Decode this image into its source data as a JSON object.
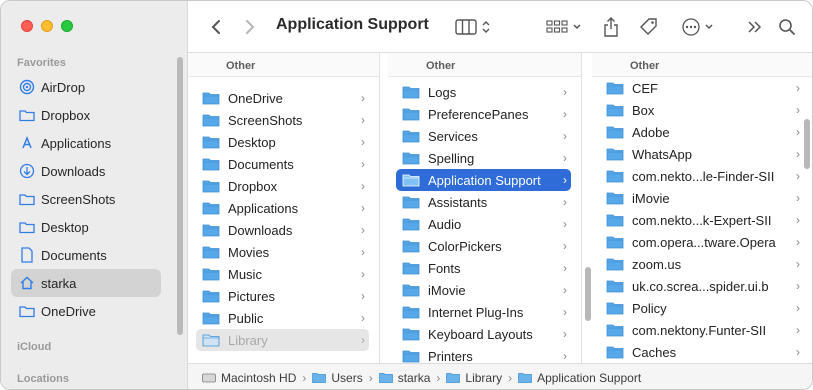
{
  "window": {
    "title": "Application Support"
  },
  "sidebar": {
    "favorites_heading": "Favorites",
    "icloud_heading": "iCloud",
    "locations_heading": "Locations",
    "items": [
      {
        "label": "AirDrop",
        "icon": "airdrop-icon"
      },
      {
        "label": "Dropbox",
        "icon": "folder-icon"
      },
      {
        "label": "Applications",
        "icon": "applications-icon"
      },
      {
        "label": "Downloads",
        "icon": "downloads-icon"
      },
      {
        "label": "ScreenShots",
        "icon": "folder-icon"
      },
      {
        "label": "Desktop",
        "icon": "folder-icon"
      },
      {
        "label": "Documents",
        "icon": "document-icon"
      },
      {
        "label": "starka",
        "icon": "home-icon",
        "selected": true
      },
      {
        "label": "OneDrive",
        "icon": "folder-icon"
      }
    ]
  },
  "columns": [
    {
      "header": "Other",
      "items": [
        "OneDrive",
        "ScreenShots",
        "Desktop",
        "Documents",
        "Dropbox",
        "Applications",
        "Downloads",
        "Movies",
        "Music",
        "Pictures",
        "Public",
        "Library"
      ]
    },
    {
      "header": "Other",
      "items": [
        "Logs",
        "PreferencePanes",
        "Services",
        "Spelling",
        "Application Support",
        "Assistants",
        "Audio",
        "ColorPickers",
        "Fonts",
        "iMovie",
        "Internet Plug-Ins",
        "Keyboard Layouts",
        "Printers"
      ]
    },
    {
      "header": "Other",
      "items": [
        "CEF",
        "Box",
        "Adobe",
        "WhatsApp",
        "com.nekto...le-Finder-SII",
        "iMovie",
        "com.nekto...k-Expert-SII",
        "com.opera...tware.Opera",
        "zoom.us",
        "uk.co.screa...spider.ui.b",
        "Policy",
        "com.nektony.Funter-SII",
        "Caches"
      ]
    }
  ],
  "pathbar": [
    "Macintosh HD",
    "Users",
    "starka",
    "Library",
    "Application Support"
  ],
  "colors": {
    "accent": "#2f6cd8",
    "folder": "#56a8e8"
  }
}
